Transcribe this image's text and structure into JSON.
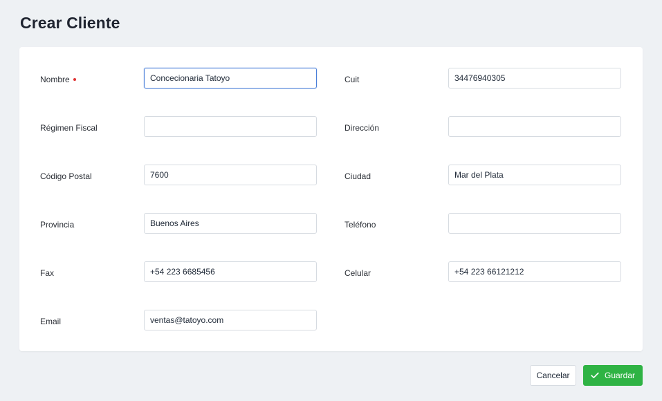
{
  "page": {
    "title": "Crear Cliente"
  },
  "form": {
    "nombre": {
      "label": "Nombre",
      "value": "Concecionaria Tatoyo",
      "required": true
    },
    "cuit": {
      "label": "Cuit",
      "value": "34476940305"
    },
    "regimen_fiscal": {
      "label": "Régimen Fiscal",
      "value": ""
    },
    "direccion": {
      "label": "Dirección",
      "value": ""
    },
    "codigo_postal": {
      "label": "Código Postal",
      "value": "7600"
    },
    "ciudad": {
      "label": "Ciudad",
      "value": "Mar del Plata"
    },
    "provincia": {
      "label": "Provincia",
      "value": "Buenos Aires"
    },
    "telefono": {
      "label": "Teléfono",
      "value": ""
    },
    "fax": {
      "label": "Fax",
      "value": "+54 223 6685456"
    },
    "celular": {
      "label": "Celular",
      "value": "+54 223 66121212"
    },
    "email": {
      "label": "Email",
      "value": "ventas@tatoyo.com"
    }
  },
  "actions": {
    "cancel_label": "Cancelar",
    "save_label": "Guardar",
    "save_icon": "check-icon"
  },
  "colors": {
    "background": "#eef1f4",
    "accent_save": "#2fb344",
    "required_marker": "#e03131",
    "focus_border": "#4a7fd9"
  }
}
